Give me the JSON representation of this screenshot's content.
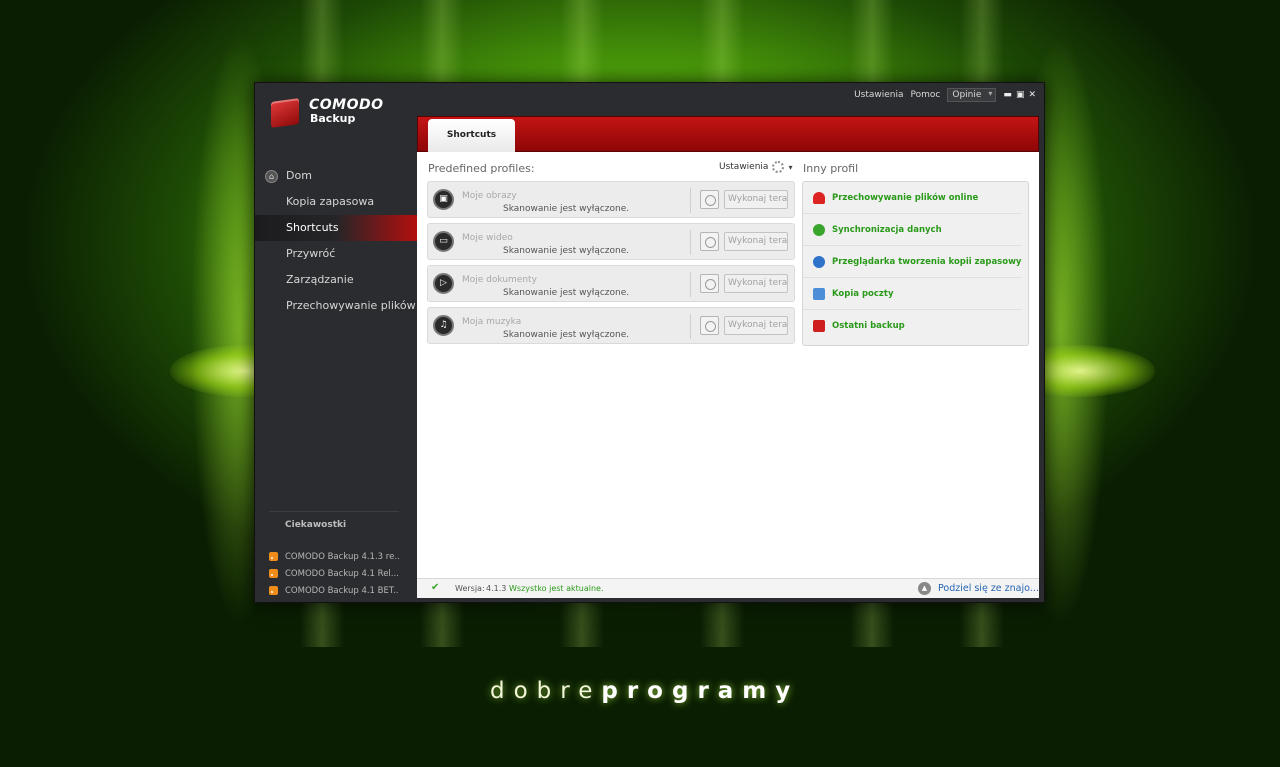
{
  "app": {
    "brand": "COMODO",
    "product": "Backup"
  },
  "top_menu": {
    "settings": "Ustawienia",
    "help": "Pomoc",
    "feedback": "Opinie",
    "minimize": "▬",
    "maximize": "▣",
    "close": "✕"
  },
  "sidebar": {
    "items": [
      {
        "label": "Dom"
      },
      {
        "label": "Kopia zapasowa"
      },
      {
        "label": "Shortcuts"
      },
      {
        "label": "Przywróć"
      },
      {
        "label": "Zarządzanie"
      },
      {
        "label": "Przechowywanie plików ..."
      }
    ],
    "news_title": "Ciekawostki",
    "news": [
      "COMODO Backup 4.1.3 re...",
      "COMODO Backup 4.1 Rel...",
      "COMODO Backup 4.1 BET..."
    ]
  },
  "tab": {
    "label": "Shortcuts"
  },
  "profiles_section": {
    "title": "Predefined profiles:",
    "settings_label": "Ustawienia"
  },
  "profiles": [
    {
      "name": "Moje obrazy",
      "status": "Skanowanie jest wyłączone.",
      "button": "Wykonaj tera...",
      "icon": "image-icon"
    },
    {
      "name": "Moje wideo",
      "status": "Skanowanie jest wyłączone.",
      "button": "Wykonaj tera...",
      "icon": "video-icon"
    },
    {
      "name": "Moje dokumenty",
      "status": "Skanowanie jest wyłączone.",
      "button": "Wykonaj tera...",
      "icon": "document-icon"
    },
    {
      "name": "Moja muzyka",
      "status": "Skanowanie jest wyłączone.",
      "button": "Wykonaj tera...",
      "icon": "music-icon"
    }
  ],
  "other_section": {
    "title": "Inny profil",
    "items": [
      {
        "label": "Przechowywanie plików online",
        "icon": "cloud-icon"
      },
      {
        "label": "Synchronizacja danych",
        "icon": "sync-icon"
      },
      {
        "label": "Przeglądarka tworzenia kopii zapasowych da...",
        "icon": "browser-icon"
      },
      {
        "label": "Kopia poczty",
        "icon": "mail-icon"
      },
      {
        "label": "Ostatni backup",
        "icon": "last-backup-icon"
      }
    ]
  },
  "status_bar": {
    "version_label": "Wersja:",
    "version": "4.1.3",
    "status": "Wszystko jest aktualne.",
    "share": "Podziel się ze znajo..."
  },
  "watermark": {
    "part1": "dobre",
    "part2": "programy"
  },
  "colors": {
    "accent_red": "#b30f0f",
    "link_green": "#2a9a1a",
    "link_blue": "#2663b0",
    "background_green": "#4a9a0a"
  }
}
